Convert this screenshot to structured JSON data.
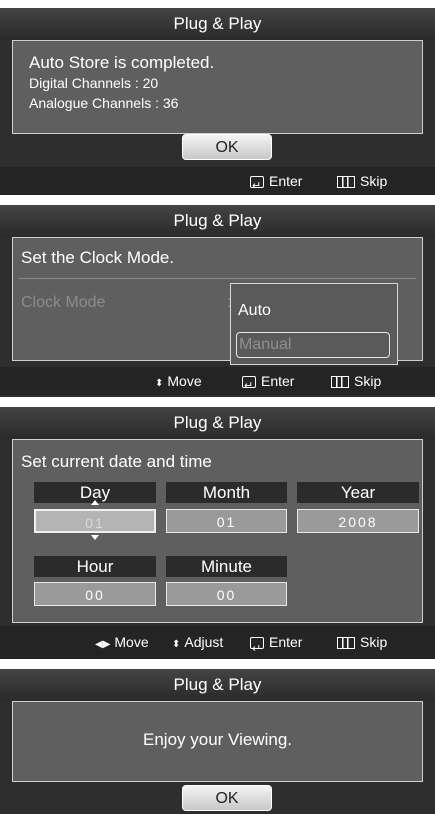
{
  "screens": {
    "s1": {
      "title": "Plug & Play",
      "line1": "Auto Store is completed.",
      "line2": "Digital Channels : 20",
      "line3": "Analogue Channels : 36",
      "ok": "OK",
      "enter": "Enter",
      "skip": "Skip"
    },
    "s2": {
      "title": "Plug & Play",
      "heading": "Set the Clock Mode.",
      "field_label": "Clock Mode",
      "colon": ":",
      "options": [
        "Auto",
        "Manual"
      ],
      "move": "Move",
      "enter": "Enter",
      "skip": "Skip"
    },
    "s3": {
      "title": "Plug & Play",
      "heading": "Set current date and time",
      "day_label": "Day",
      "day_value": "01",
      "month_label": "Month",
      "month_value": "01",
      "year_label": "Year",
      "year_value": "2008",
      "hour_label": "Hour",
      "hour_value": "00",
      "minute_label": "Minute",
      "minute_value": "00",
      "move": "Move",
      "adjust": "Adjust",
      "enter": "Enter",
      "skip": "Skip"
    },
    "s4": {
      "title": "Plug & Play",
      "message": "Enjoy your Viewing.",
      "ok": "OK"
    }
  }
}
